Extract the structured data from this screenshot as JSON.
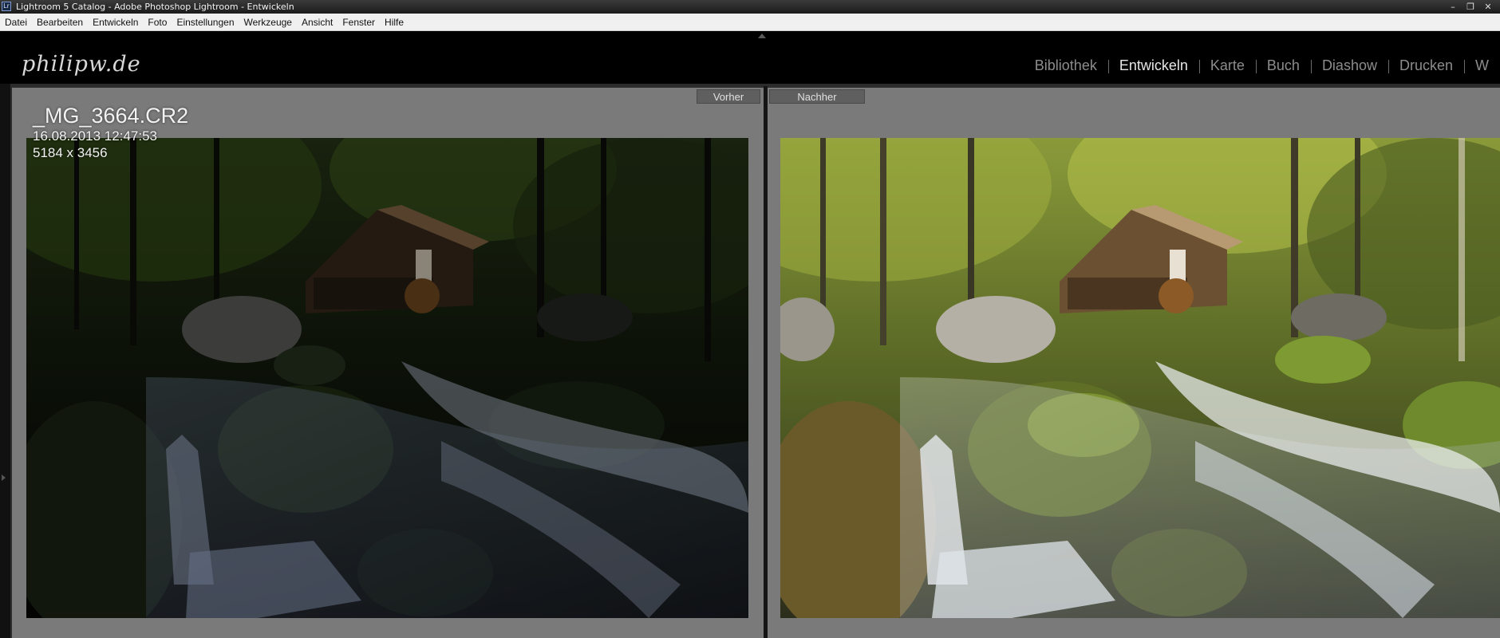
{
  "window": {
    "title": "Lightroom 5 Catalog - Adobe Photoshop Lightroom - Entwickeln",
    "app_icon": "Lr"
  },
  "menubar": {
    "items": [
      "Datei",
      "Bearbeiten",
      "Entwickeln",
      "Foto",
      "Einstellungen",
      "Werkzeuge",
      "Ansicht",
      "Fenster",
      "Hilfe"
    ]
  },
  "header": {
    "brand": "philipw.de",
    "modules": [
      {
        "label": "Bibliothek",
        "active": false
      },
      {
        "label": "Entwickeln",
        "active": true
      },
      {
        "label": "Karte",
        "active": false
      },
      {
        "label": "Buch",
        "active": false
      },
      {
        "label": "Diashow",
        "active": false
      },
      {
        "label": "Drucken",
        "active": false
      },
      {
        "label": "W",
        "active": false
      }
    ]
  },
  "compare": {
    "before_label": "Vorher",
    "after_label": "Nachher",
    "info": {
      "filename": "_MG_3664.CR2",
      "datetime": "16.08.2013 12:47:53",
      "dimensions": "5184 x 3456"
    }
  },
  "colors": {
    "accent": "#e6e6e6",
    "panel_bg": "#7a7a7a",
    "inactive_module": "#8c8c8c"
  },
  "icons": [
    "lightroom-app-icon",
    "minimize-icon",
    "restore-icon",
    "close-icon",
    "collapse-arrow-icon",
    "panel-handle-icon"
  ]
}
